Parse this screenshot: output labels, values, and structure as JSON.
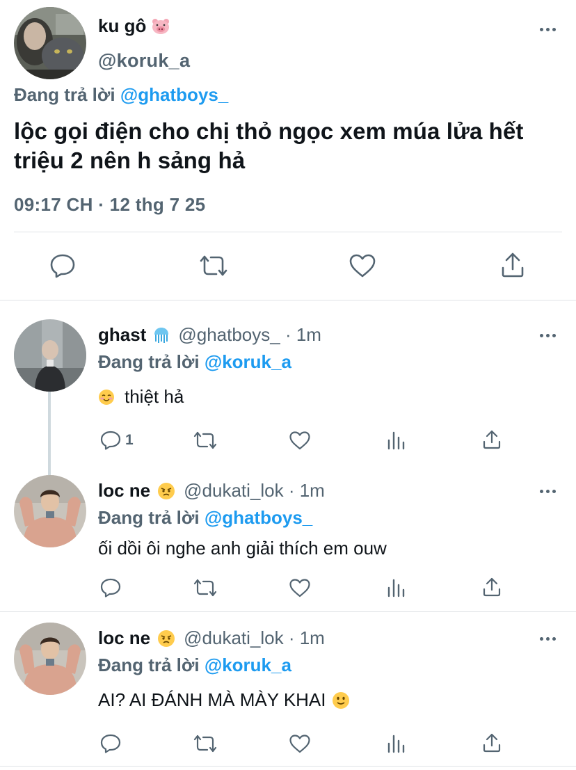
{
  "main_tweet": {
    "name": "ku gô",
    "name_emoji": "pig-face-icon",
    "handle": "@koruk_a",
    "reply_prefix": "Đang trả lời",
    "reply_to": "@ghatboys_",
    "text": "lộc gọi điện cho chị thỏ ngọc xem múa lửa hết triệu 2 nên h sảng hả",
    "timestamp": "09:17 CH · 12 thg 7 25",
    "actions": [
      "reply-icon",
      "retweet-icon",
      "like-icon",
      "share-icon"
    ]
  },
  "replies": [
    {
      "name": "ghast",
      "name_emoji": "jellyfish-icon",
      "handle_time": "@ghatboys_ · 1m",
      "reply_prefix": "Đang trả lời",
      "reply_to": "@koruk_a",
      "text": "thiệt hả",
      "text_emoji_before": "smiling-face-icon",
      "reply_count": "1"
    },
    {
      "name": "loc ne",
      "name_emoji": "angry-face-icon",
      "handle_time": "@dukati_lok · 1m",
      "reply_prefix": "Đang trả lời",
      "reply_to": "@ghatboys_",
      "text": "ối dồi ôi nghe anh giải thích em ouw",
      "reply_count": ""
    },
    {
      "name": "loc ne",
      "name_emoji": "angry-face-icon",
      "handle_time": "@dukati_lok · 1m",
      "reply_prefix": "Đang trả lời",
      "reply_to": "@koruk_a",
      "text": "AI? AI ĐÁNH MÀ MÀY KHAI",
      "text_emoji_after": "slightly-smiling-face-icon",
      "reply_count": ""
    }
  ],
  "colors": {
    "text": "#0f1419",
    "secondary": "#536471",
    "accent": "#1d9bf0",
    "divider": "#dfe3e6",
    "thread_line": "#cfd9de"
  }
}
